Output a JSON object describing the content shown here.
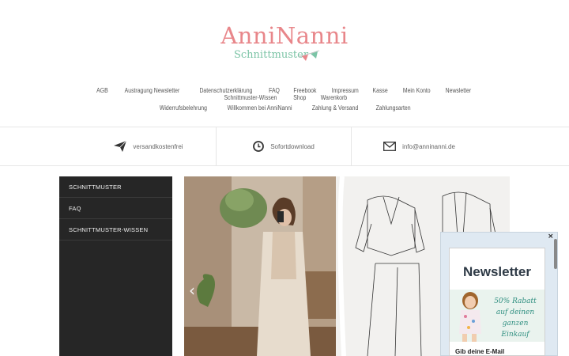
{
  "logo": {
    "name": "AnniNanni",
    "subtitle": "Schnittmuster"
  },
  "nav": {
    "row1": [
      "AGB",
      "Austragung Newsletter",
      "Datenschutzerklärung",
      "FAQ",
      "Freebook",
      "Impressum",
      "Kasse",
      "Mein Konto",
      "Newsletter",
      "Schnittmuster-Wissen",
      "Shop",
      "Warenkorb"
    ],
    "row2": [
      "Widerrufsbelehrung",
      "Willkommen bei AnniNanni",
      "Zahlung & Versand",
      "Zahlungsarten"
    ]
  },
  "usps": {
    "shipping": {
      "icon": "paper-plane-icon",
      "text": "versandkostenfrei"
    },
    "download": {
      "icon": "clock-icon",
      "text": "Sofortdownload"
    },
    "email": {
      "icon": "envelope-icon",
      "text": "info@anninanni.de"
    }
  },
  "sidebar": {
    "items": [
      {
        "label": "SCHNITTMUSTER"
      },
      {
        "label": "FAQ"
      },
      {
        "label": "SCHNITTMUSTER-WISSEN"
      }
    ]
  },
  "hero": {
    "prev_arrow": "‹"
  },
  "popup": {
    "close": "×",
    "title": "Newsletter",
    "banner_text": "50% Rabatt auf deinen ganzen Einkauf",
    "subtitle": "Gib deine E-Mail"
  },
  "colors": {
    "brand_pink": "#e8868a",
    "brand_mint": "#7cc4a6",
    "sidebar_bg": "#262626"
  }
}
